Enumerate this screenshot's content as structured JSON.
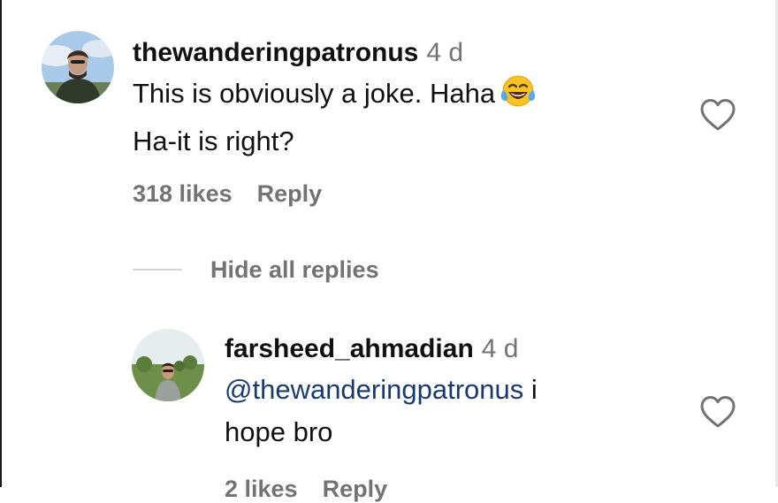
{
  "comment": {
    "username": "thewanderingpatronus",
    "time": "4 d",
    "text_line1": "This is obviously a joke. Haha",
    "emoji": "face-with-tears-of-joy",
    "text_line2": "Ha-it is right?",
    "likes": "318 likes",
    "reply_label": "Reply",
    "like_icon": "heart-outline-icon"
  },
  "toggle_replies": {
    "label": "Hide all replies"
  },
  "reply": {
    "username": "farsheed_ahmadian",
    "time": "4 d",
    "mention": "@thewanderingpatronus",
    "text_after_mention": " i",
    "text_line2": "hope bro",
    "likes": "2 likes",
    "reply_label": "Reply",
    "like_icon": "heart-outline-icon"
  },
  "colors": {
    "text": "#111111",
    "muted": "#737373",
    "mention": "#1a3a6c",
    "divider": "#d6d6d6"
  }
}
